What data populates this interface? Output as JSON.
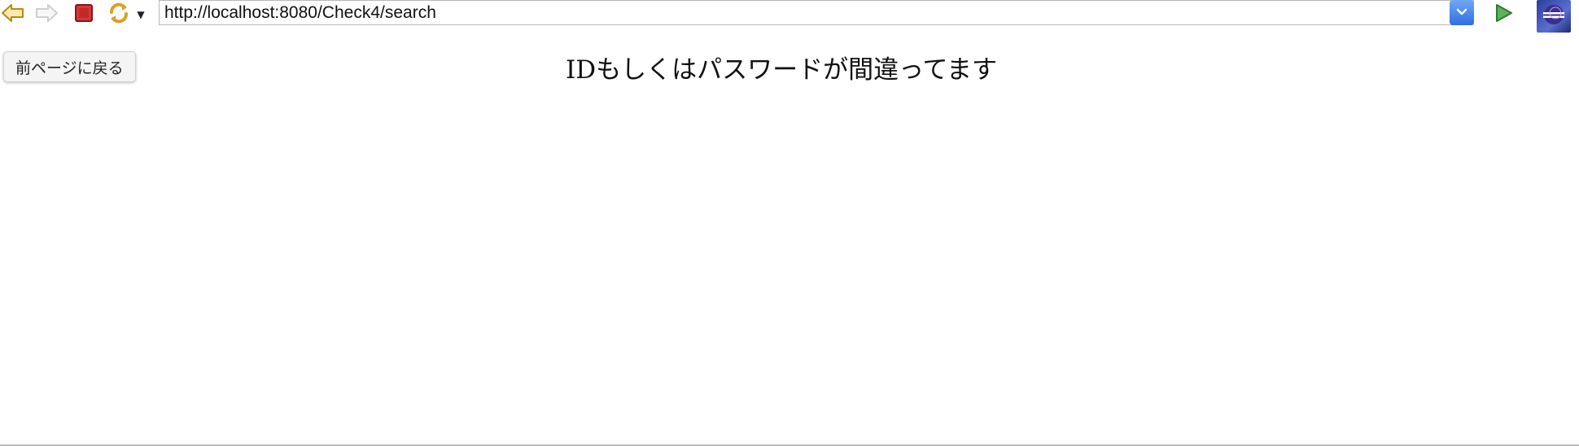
{
  "toolbar": {
    "back_icon": "back-arrow-icon",
    "forward_icon": "forward-arrow-icon",
    "stop_icon": "stop-icon",
    "refresh_icon": "refresh-icon",
    "refresh_menu_icon": "dropdown-triangle-icon",
    "go_icon": "go-play-icon",
    "brand_icon": "eclipse-icon",
    "accent_color": "#2f6fe0"
  },
  "address_bar": {
    "url": "http://localhost:8080/Check4/search"
  },
  "page": {
    "back_button_label": "前ページに戻る",
    "message": "IDもしくはパスワードが間違ってます"
  }
}
